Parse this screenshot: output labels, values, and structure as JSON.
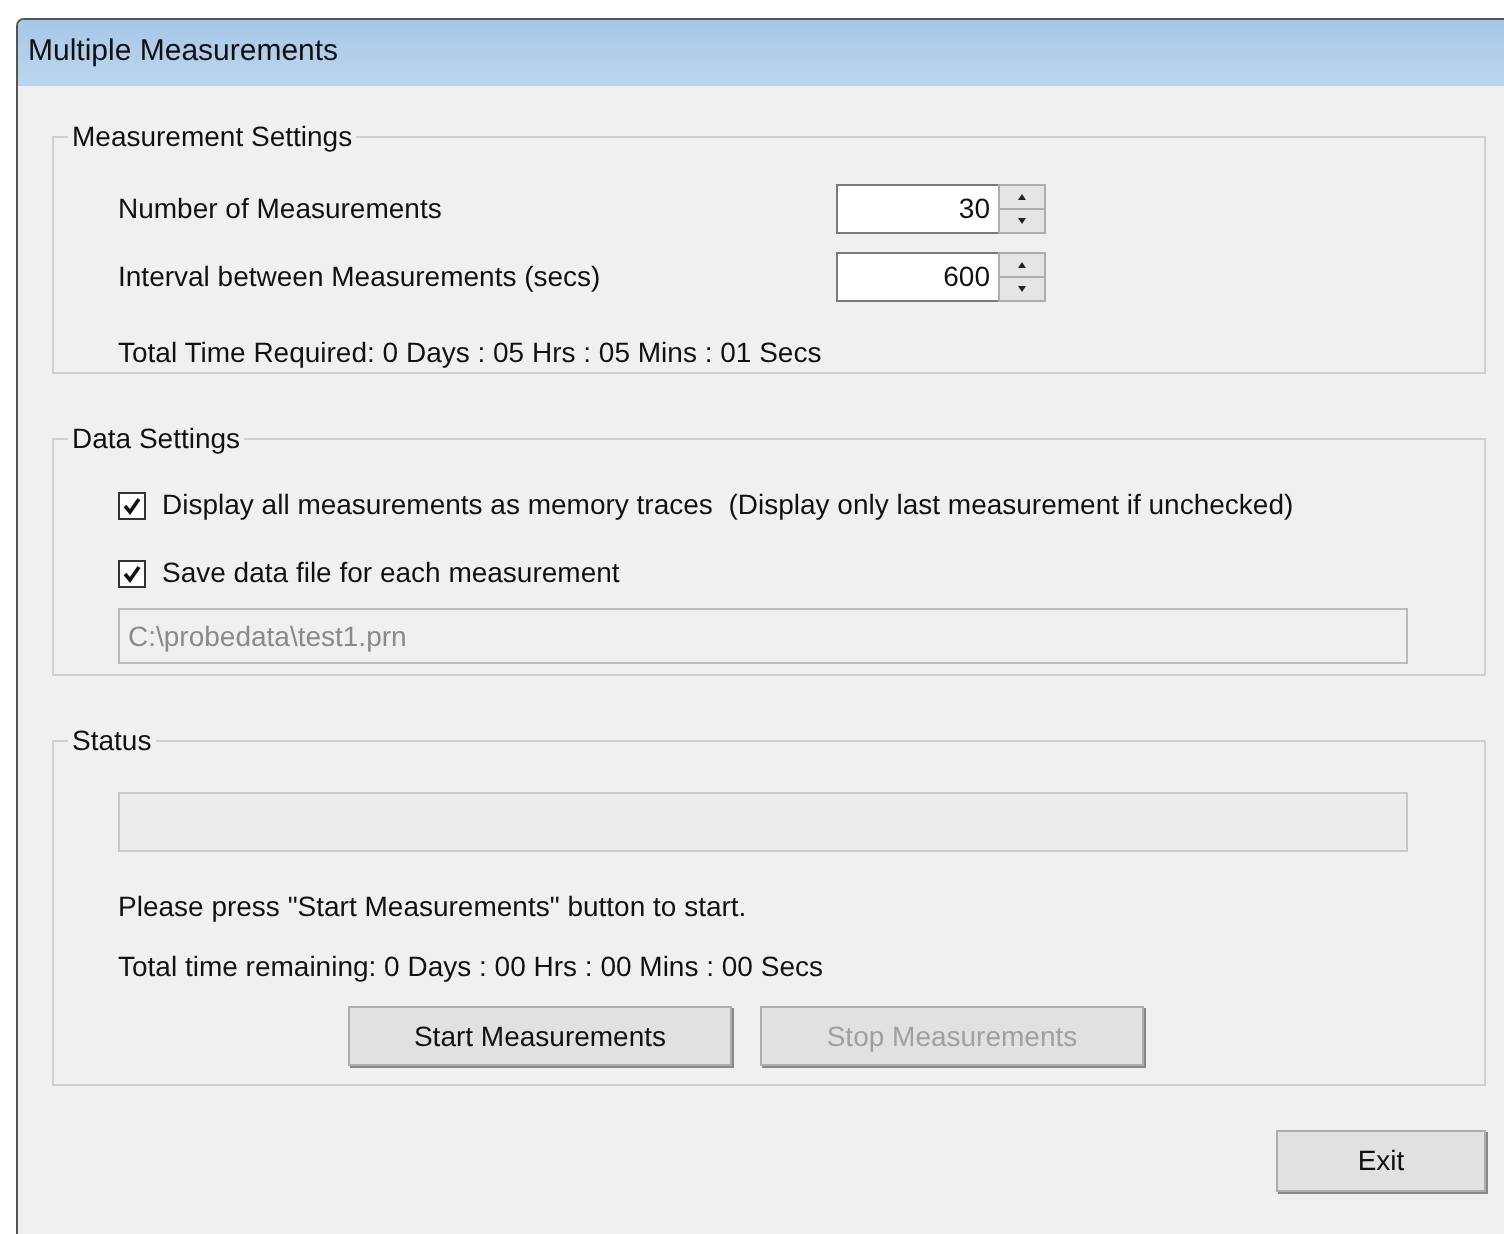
{
  "window": {
    "title": "Multiple Measurements"
  },
  "measurement_settings": {
    "title": "Measurement Settings",
    "fields": [
      {
        "label": "Number of Measurements",
        "value": "30"
      },
      {
        "label": "Interval between Measurements (secs)",
        "value": "600"
      }
    ],
    "total_time": "Total Time Required: 0 Days : 05 Hrs : 05 Mins : 01 Secs"
  },
  "data_settings": {
    "title": "Data Settings",
    "options": [
      {
        "label": "Display all measurements as memory traces  (Display only last measurement if unchecked)",
        "checked": true
      },
      {
        "label": "Save data file for each measurement",
        "checked": true
      }
    ],
    "file_path": {
      "value": "C:\\probedata\\test1.prn",
      "disabled": true
    }
  },
  "status": {
    "title": "Status",
    "progress": {
      "level": 0
    },
    "message": "Please press \"Start Measurements\" button to start.",
    "remaining": "Total time remaining: 0 Days : 00 Hrs : 00 Mins : 00 Secs",
    "buttons": [
      {
        "label": "Start Measurements",
        "disabled": false
      },
      {
        "label": "Stop Measurements",
        "disabled": true
      }
    ]
  },
  "exit_button": {
    "label": "Exit"
  }
}
